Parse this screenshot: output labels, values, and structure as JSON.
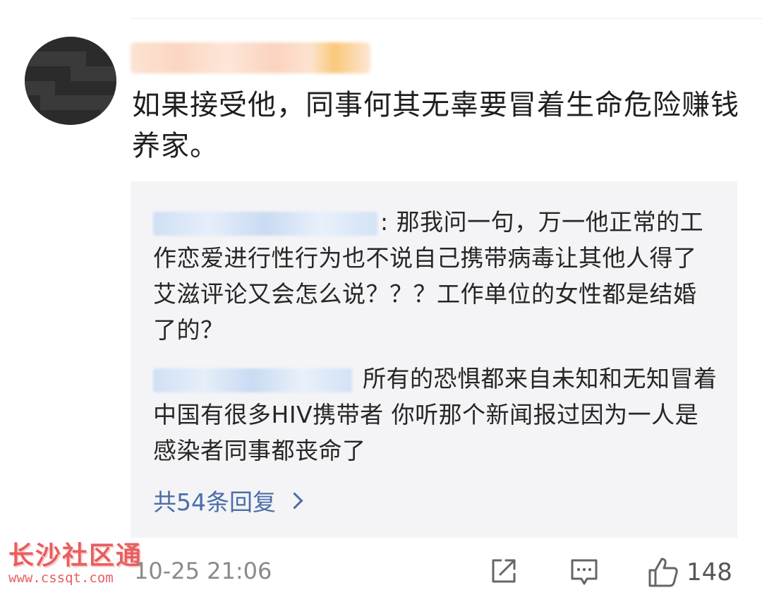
{
  "comment": {
    "text": "如果接受他，同事何其无辜要冒着生命危险赚钱养家。",
    "timestamp": "10-25 21:06",
    "like_count": "148"
  },
  "replies": [
    {
      "text": ": 那我问一句，万一他正常的工作恋爱进行性行为也不说自己携带病毒让其他人得了艾滋评论又会怎么说？？？工作单位的女性都是结婚了的？"
    },
    {
      "text": " 所有的恐惧都来自未知和无知冒着 中国有很多HIV携带者 你听那个新闻报过因为一人是感染者同事都丧命了"
    }
  ],
  "more_replies": {
    "label": "共54条回复"
  },
  "watermark": {
    "title": "长沙社区通",
    "url": "www.cssqt.com"
  },
  "icons": [
    "share-icon",
    "comment-icon",
    "like-icon",
    "chevron-right-icon"
  ],
  "colors": {
    "link": "#4a6ea9",
    "reply_bg": "#f4f4f6",
    "watermark": "#e85e5e"
  }
}
